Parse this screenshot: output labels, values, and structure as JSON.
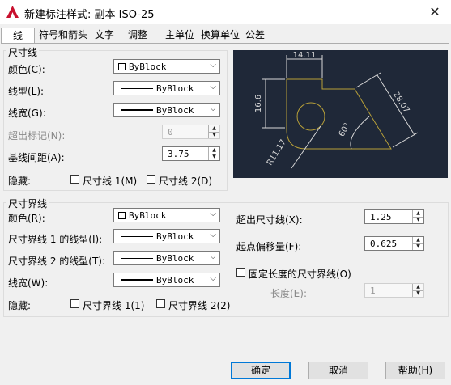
{
  "window": {
    "title": "新建标注样式: 副本 ISO-25"
  },
  "tabs": [
    "线",
    "符号和箭头",
    "文字",
    "调整",
    "主单位",
    "换算单位",
    "公差"
  ],
  "dim_lines": {
    "group_title": "尺寸线",
    "color_label": "颜色(C):",
    "color_value": "ByBlock",
    "linetype_label": "线型(L):",
    "linetype_value": "ByBlock",
    "lineweight_label": "线宽(G):",
    "lineweight_value": "ByBlock",
    "extend_label": "超出标记(N):",
    "extend_value": "0",
    "baseline_label": "基线间距(A):",
    "baseline_value": "3.75",
    "suppress_label": "隐藏:",
    "suppress1": "尺寸线 1(M)",
    "suppress2": "尺寸线 2(D)"
  },
  "ext_lines": {
    "group_title": "尺寸界线",
    "color_label": "颜色(R):",
    "color_value": "ByBlock",
    "lt1_label": "尺寸界线 1 的线型(I):",
    "lt1_value": "ByBlock",
    "lt2_label": "尺寸界线 2 的线型(T):",
    "lt2_value": "ByBlock",
    "lw_label": "线宽(W):",
    "lw_value": "ByBlock",
    "suppress_label": "隐藏:",
    "suppress1": "尺寸界线 1(1)",
    "suppress2": "尺寸界线 2(2)",
    "extend_beyond_label": "超出尺寸线(X):",
    "extend_beyond_value": "1.25",
    "offset_label": "起点偏移量(F):",
    "offset_value": "0.625",
    "fixed_label": "固定长度的尺寸界线(O)",
    "length_label": "长度(E):",
    "length_value": "1"
  },
  "preview": {
    "dims": [
      "14.11",
      "16.6",
      "28.07",
      "60°",
      "R11.17"
    ]
  },
  "buttons": {
    "ok": "确定",
    "cancel": "取消",
    "help": "帮助(H)"
  }
}
